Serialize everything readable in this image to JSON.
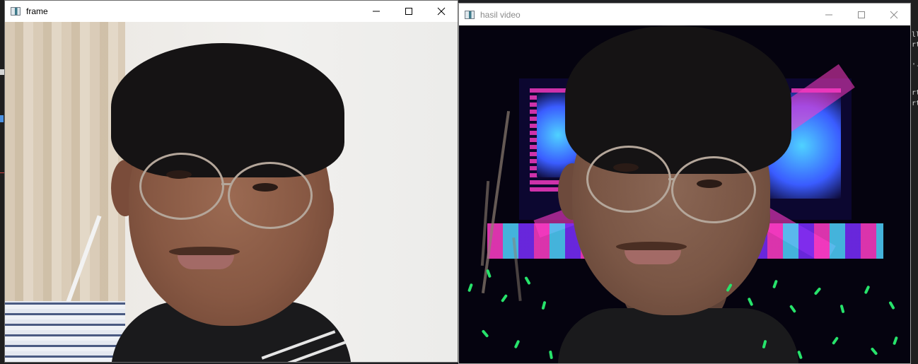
{
  "windows": {
    "frame": {
      "title": "frame",
      "buttons": {
        "minimize": "minimize-icon",
        "maximize": "maximize-icon",
        "close": "close-icon"
      }
    },
    "hasil": {
      "title": "hasil video",
      "buttons": {
        "minimize": "minimize-icon",
        "maximize": "maximize-icon",
        "close": "close-icon"
      }
    }
  },
  "background_edge_text": {
    "right_lines": [
      "ll",
      "rt",
      "'-",
      "rt",
      "rt"
    ]
  },
  "colors": {
    "titlebar": "#ffffff",
    "title_text_active": "#000000",
    "title_text_inactive": "#8a8a8a",
    "stage_pink": "#ff3cc8",
    "stage_blue": "#4fd2ff",
    "crowd_green": "#27e36b"
  }
}
